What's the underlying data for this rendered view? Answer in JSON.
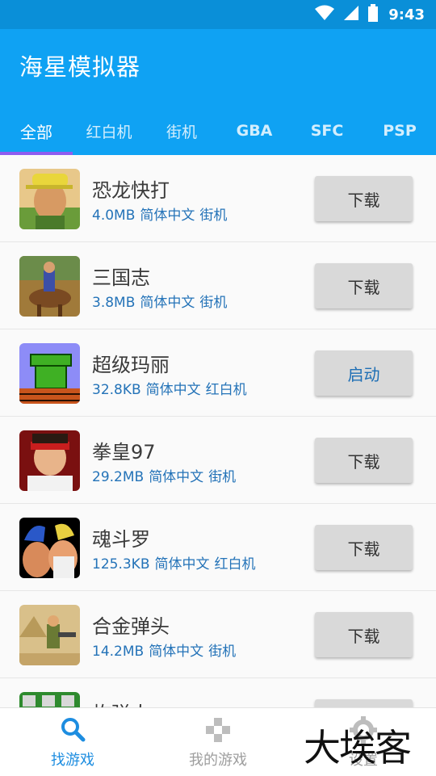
{
  "status_bar": {
    "time": "9:43"
  },
  "app": {
    "title": "海星模拟器"
  },
  "tabs": [
    {
      "label": "全部",
      "active": true
    },
    {
      "label": "红白机"
    },
    {
      "label": "街机"
    },
    {
      "label": "GBA"
    },
    {
      "label": "SFC"
    },
    {
      "label": "PSP"
    }
  ],
  "games": [
    {
      "name": "恐龙快打",
      "size": "4.0MB",
      "lang": "简体中文",
      "platform": "街机",
      "button": "下载"
    },
    {
      "name": "三国志",
      "size": "3.8MB",
      "lang": "简体中文",
      "platform": "街机",
      "button": "下载"
    },
    {
      "name": "超级玛丽",
      "size": "32.8KB",
      "lang": "简体中文",
      "platform": "红白机",
      "button": "启动"
    },
    {
      "name": "拳皇97",
      "size": "29.2MB",
      "lang": "简体中文",
      "platform": "街机",
      "button": "下载"
    },
    {
      "name": "魂斗罗",
      "size": "125.3KB",
      "lang": "简体中文",
      "platform": "红白机",
      "button": "下载"
    },
    {
      "name": "合金弹头",
      "size": "14.2MB",
      "lang": "简体中文",
      "platform": "街机",
      "button": "下载"
    },
    {
      "name": "炸弹人",
      "size": "",
      "lang": "",
      "platform": "",
      "button": ""
    }
  ],
  "bottom_nav": [
    {
      "label": "找游戏",
      "icon": "search-icon",
      "active": true
    },
    {
      "label": "我的游戏",
      "icon": "gamepad-icon"
    },
    {
      "label": "设置",
      "icon": "gear-icon"
    }
  ],
  "watermark": "大埃客",
  "colors": {
    "appbar": "#0fa2f3",
    "statusbar": "#0a8fd8",
    "indicator": "#8e5cf0",
    "meta_text": "#2473b8",
    "nav_active": "#1d8de0"
  }
}
